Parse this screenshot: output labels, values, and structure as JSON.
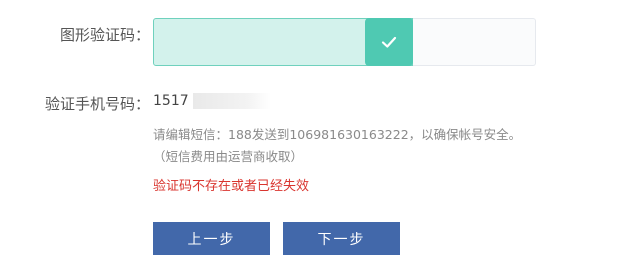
{
  "form": {
    "captcha_label": "图形验证码：",
    "phone_label": "验证手机号码：",
    "phone_visible": "1517",
    "hint_line_1": "请编辑短信：188发送到106981630163222，以确保帐号安全。",
    "hint_line_2": "（短信费用由运营商收取）",
    "error_message": "验证码不存在或者已经失效",
    "captcha_state": "verified"
  },
  "buttons": {
    "prev_label": "上一步",
    "next_label": "下一步"
  },
  "colors": {
    "slider_fill": "#d3f2ec",
    "slider_border": "#6fd1bd",
    "check_bg": "#4fc9b2",
    "error": "#d9352f",
    "button_bg": "#4268aa"
  },
  "icons": {
    "captcha_check": "checkmark-icon"
  }
}
